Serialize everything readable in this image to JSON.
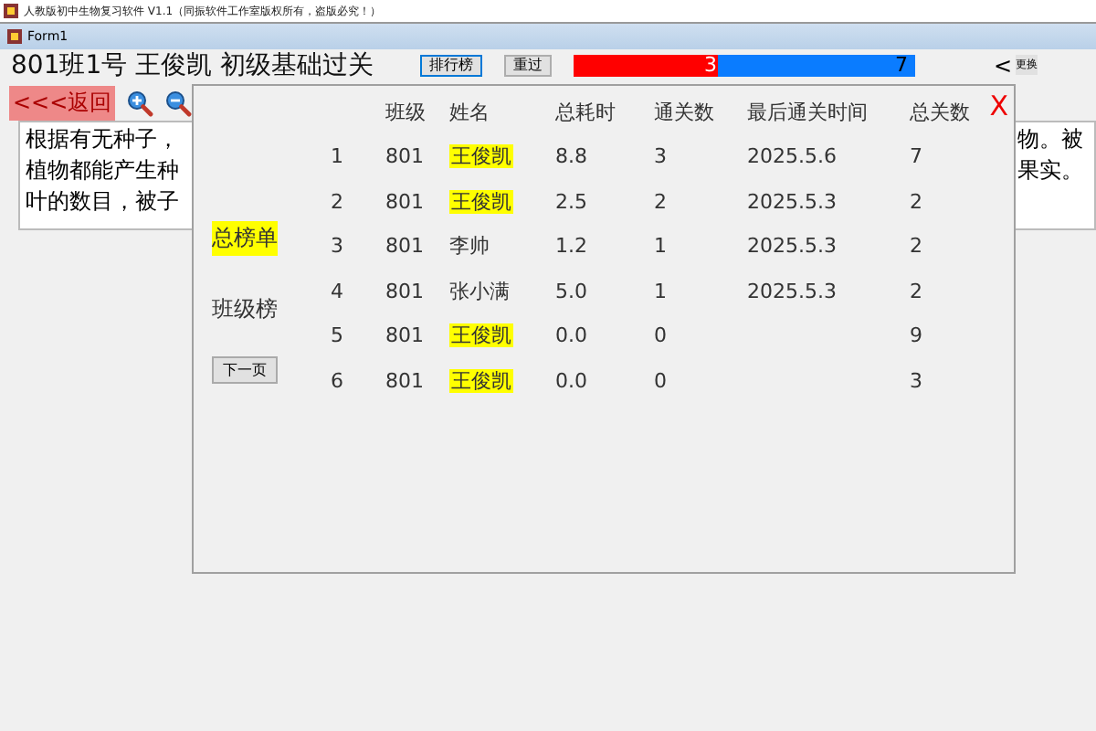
{
  "app_title": "人教版初中生物复习软件 V1.1（同振软件工作室版权所有，盗版必究！）",
  "window": {
    "title": "Form1"
  },
  "header": {
    "title": "801班1号 王俊凯 初级基础过关",
    "buttons": [
      "排行榜",
      "重过"
    ],
    "progress": {
      "level": 0.42,
      "left_label": "3",
      "right_label": "7"
    },
    "right_arrow": "<",
    "right_button": "更换"
  },
  "toolbar": {
    "back": "<<<返回"
  },
  "passage": {
    "left_lines": [
      "根据有无种子，",
      "植物都能产生种",
      "叶的数目，被子"
    ],
    "right_lines": [
      "物。被",
      "果实。"
    ]
  },
  "leaderboard": {
    "close": "X",
    "tabs": [
      {
        "label": "总榜单",
        "selected": true
      },
      {
        "label": "班级榜",
        "selected": false
      }
    ],
    "next_page": "下一页",
    "columns": [
      "",
      "班级",
      "姓名",
      "总耗时",
      "通关数",
      "最后通关时间",
      "总关数"
    ],
    "rows": [
      {
        "cells": [
          "1",
          "801",
          "王俊凯",
          "8.8",
          "3",
          "2025.5.6",
          "7"
        ],
        "highlighted": true
      },
      {
        "cells": [
          "2",
          "801",
          "王俊凯",
          "2.5",
          "2",
          "2025.5.3",
          "2"
        ],
        "highlighted": true
      },
      {
        "cells": [
          "3",
          "801",
          "李帅",
          "1.2",
          "1",
          "2025.5.3",
          "2"
        ],
        "highlighted": false
      },
      {
        "cells": [
          "4",
          "801",
          "张小满",
          "5.0",
          "1",
          "2025.5.3",
          "2"
        ],
        "highlighted": false
      },
      {
        "cells": [
          "5",
          "801",
          "王俊凯",
          "0.0",
          "0",
          "",
          "9"
        ],
        "highlighted": true
      },
      {
        "cells": [
          "6",
          "801",
          "王俊凯",
          "0.0",
          "0",
          "",
          "3"
        ],
        "highlighted": true
      }
    ]
  }
}
